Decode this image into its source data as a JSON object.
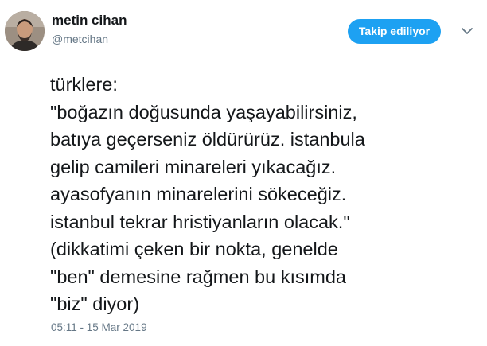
{
  "author": {
    "display_name": "metin cihan",
    "username": "@metcihan"
  },
  "follow_button": {
    "label": "Takip ediliyor"
  },
  "menu": {
    "icon": "chevron-down-icon"
  },
  "tweet": {
    "text": "türklere:\n\"boğazın doğusunda yaşayabilirsiniz,\nbatıya geçerseniz öldürürüz. istanbula\ngelip camileri minareleri yıkacağız.\nayasofyanın minarelerini sökeceğiz.\nistanbul tekrar hristiyanların olacak.\"\n(dikkatimi çeken bir nokta, genelde\n\"ben\" demesine rağmen bu kısımda\n\"biz\" diyor)",
    "timestamp": "05:11 - 15 Mar 2019"
  },
  "colors": {
    "accent": "#1da1f2",
    "text": "#14171a",
    "secondary_text": "#657786",
    "background": "#ffffff"
  }
}
